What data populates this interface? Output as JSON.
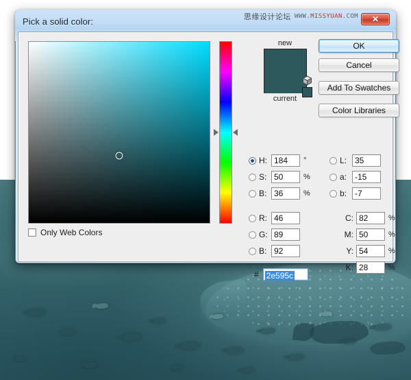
{
  "desktop": {
    "wallpaper_description": "underwater-scene-whale-shark"
  },
  "watermark": {
    "chinese": "思缘设计论坛",
    "url_prefix": "WWW.",
    "url_brand": "MISSYUAN",
    "url_suffix": ".COM"
  },
  "dialog": {
    "title": "Pick a solid color:",
    "close_label": "✕"
  },
  "buttons": {
    "ok": "OK",
    "cancel": "Cancel",
    "add_to_swatches": "Add To Swatches",
    "color_libraries": "Color Libraries"
  },
  "preview": {
    "new_label": "new",
    "current_label": "current",
    "new_color": "#2e595c",
    "current_color": "#2e595c",
    "alert_swatch_color": "#2e595c",
    "alert_icon": "cube-icon"
  },
  "options": {
    "only_web_colors_label": "Only Web Colors",
    "only_web_colors_checked": false
  },
  "picker": {
    "hue_degrees": 184,
    "field_hue_color": "#00dcff",
    "marker_x_pct": 50,
    "marker_y_pct": 63,
    "hue_thumb_pct": 50
  },
  "color_values": {
    "hsb": [
      {
        "key": "H",
        "label": "H:",
        "value": "184",
        "unit": "°",
        "selected": true
      },
      {
        "key": "S",
        "label": "S:",
        "value": "50",
        "unit": "%",
        "selected": false
      },
      {
        "key": "B",
        "label": "B:",
        "value": "36",
        "unit": "%",
        "selected": false
      }
    ],
    "rgb": [
      {
        "key": "R",
        "label": "R:",
        "value": "46",
        "unit": "",
        "selected": false
      },
      {
        "key": "G",
        "label": "G:",
        "value": "89",
        "unit": "",
        "selected": false
      },
      {
        "key": "B",
        "label": "B:",
        "value": "92",
        "unit": "",
        "selected": false
      }
    ],
    "lab": [
      {
        "key": "L",
        "label": "L:",
        "value": "35",
        "unit": "",
        "selected": false
      },
      {
        "key": "a",
        "label": "a:",
        "value": "-15",
        "unit": "",
        "selected": false
      },
      {
        "key": "b",
        "label": "b:",
        "value": "-7",
        "unit": "",
        "selected": false
      }
    ],
    "cmyk": [
      {
        "key": "C",
        "label": "C:",
        "value": "82",
        "unit": "%"
      },
      {
        "key": "M",
        "label": "M:",
        "value": "50",
        "unit": "%"
      },
      {
        "key": "Y",
        "label": "Y:",
        "value": "54",
        "unit": "%"
      },
      {
        "key": "K",
        "label": "K:",
        "value": "28",
        "unit": "%"
      }
    ],
    "hex": {
      "prefix": "#",
      "value": "2e595c",
      "selected": true
    }
  }
}
